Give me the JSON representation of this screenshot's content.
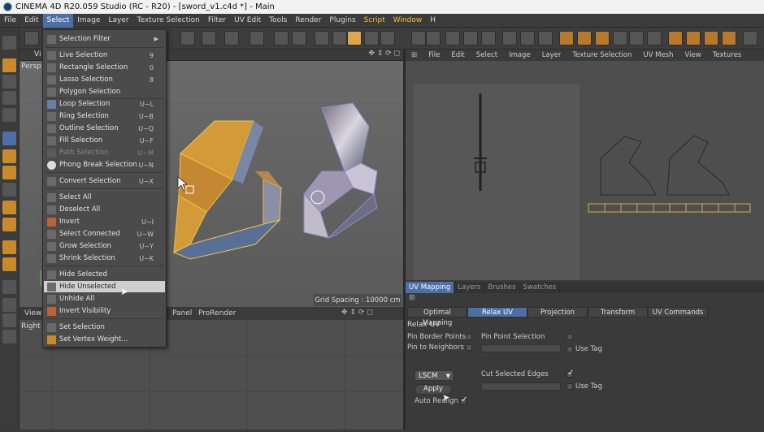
{
  "title": "CINEMA 4D R20.059 Studio (RC - R20) - [sword_v1.c4d *] - Main",
  "menubar": [
    "File",
    "Edit",
    "Select",
    "Image",
    "Layer",
    "Texture Selection",
    "Filter",
    "UV Edit",
    "Tools",
    "Render",
    "Plugins",
    "Script",
    "Window",
    "H"
  ],
  "select_menu": {
    "filter": "Selection Filter",
    "items": [
      {
        "label": "Live Selection",
        "shortcut": "9"
      },
      {
        "label": "Rectangle Selection",
        "shortcut": "0"
      },
      {
        "label": "Lasso Selection",
        "shortcut": "8"
      },
      {
        "label": "Polygon Selection",
        "shortcut": ""
      },
      {
        "label": "Loop Selection",
        "shortcut": "U~L"
      },
      {
        "label": "Ring Selection",
        "shortcut": "U~B"
      },
      {
        "label": "Outline Selection",
        "shortcut": "U~Q"
      },
      {
        "label": "Fill Selection",
        "shortcut": "U~F"
      },
      {
        "label": "Path Selection",
        "shortcut": "U~M"
      },
      {
        "label": "Phong Break Selection",
        "shortcut": "U~N"
      },
      {
        "label": "Convert Selection",
        "shortcut": "U~X"
      },
      {
        "label": "Select All",
        "shortcut": ""
      },
      {
        "label": "Deselect All",
        "shortcut": ""
      },
      {
        "label": "Invert",
        "shortcut": "U~I"
      },
      {
        "label": "Select Connected",
        "shortcut": "U~W"
      },
      {
        "label": "Grow Selection",
        "shortcut": "U~Y"
      },
      {
        "label": "Shrink Selection",
        "shortcut": "U~K"
      },
      {
        "label": "Hide Selected",
        "shortcut": ""
      },
      {
        "label": "Hide Unselected",
        "shortcut": ""
      },
      {
        "label": "Unhide All",
        "shortcut": ""
      },
      {
        "label": "Invert Visibility",
        "shortcut": ""
      },
      {
        "label": "Set Selection",
        "shortcut": ""
      },
      {
        "label": "Set Vertex Weight...",
        "shortcut": ""
      }
    ]
  },
  "viewport": {
    "header": "Vi",
    "camera": "Persp",
    "grid_spacing": "Grid Spacing : 10000 cm"
  },
  "bottom_viewport": {
    "menu": [
      "View",
      "Panel",
      "ProRender"
    ],
    "camera": "Right"
  },
  "uv_editor_menu": [
    "File",
    "Edit",
    "Select",
    "Image",
    "Layer",
    "Texture Selection",
    "UV Mesh",
    "View",
    "Textures"
  ],
  "panel_tabs": [
    "UV Mapping",
    "Layers",
    "Brushes",
    "Swatches"
  ],
  "sub_tabs": [
    "Optimal Mapping",
    "Relax UV",
    "Projection",
    "Transform",
    "UV Commands"
  ],
  "relax": {
    "title": "Relax UV",
    "pin_border_points": "Pin Border Points",
    "pin_to_neighbors": "Pin to Neighbors",
    "pin_point_selection": "Pin Point Selection",
    "use_tag": "Use Tag",
    "cut_selected_edges": "Cut Selected Edges",
    "use_tag_2": "Use Tag",
    "method": "LSCM",
    "apply": "Apply",
    "auto_realign": "Auto Realign"
  },
  "colors": {
    "accent": "#4d6fa6",
    "script_menu": "#f2c33d",
    "object_orange": "#e0a64a"
  }
}
